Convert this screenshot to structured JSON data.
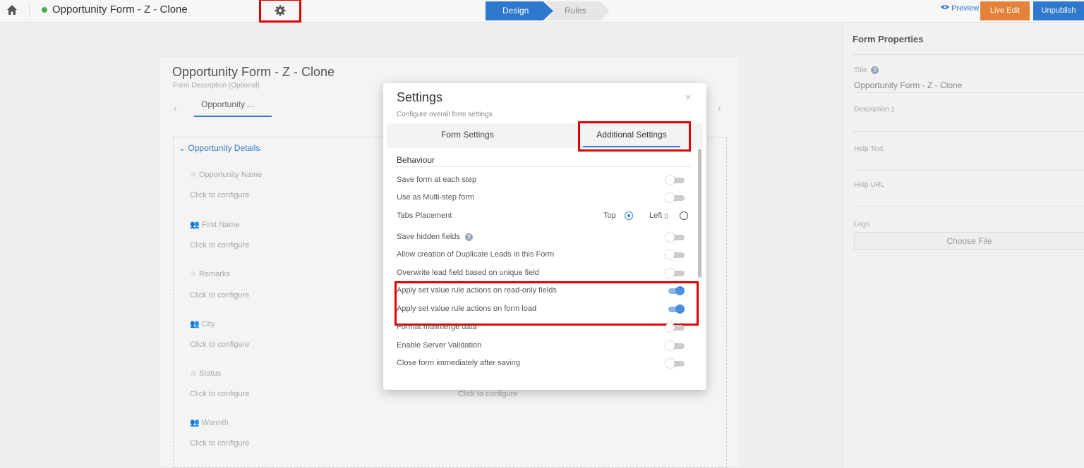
{
  "topbar": {
    "form_name": "Opportunity Form - Z - Clone",
    "steps": [
      "Design",
      "Rules"
    ],
    "preview_label": "Preview",
    "live_edit_label": "Live Edit",
    "unpublish_label": "Unpublish"
  },
  "properties": {
    "heading": "Form Properties",
    "title_label": "Title",
    "title_value": "Opportunity Form - Z - Clone",
    "description_label": "Description",
    "help_text_label": "Help Text",
    "help_url_label": "Help URL",
    "logo_label": "Logo",
    "choose_file_label": "Choose File"
  },
  "canvas": {
    "title": "Opportunity Form - Z - Clone",
    "description_placeholder": "Form Description (Optional)",
    "tab_label": "Opportunity ...",
    "section_title": "Opportunity Details",
    "configure_text": "Click to configure",
    "fields": [
      {
        "label": "Opportunity Name",
        "icon": "field-icon"
      },
      {
        "label": "First Name",
        "icon": "users-icon"
      },
      {
        "label": "Remarks",
        "icon": "field-icon"
      },
      {
        "label": "City",
        "icon": "users-icon"
      },
      {
        "label": "Status",
        "icon": "field-icon"
      },
      {
        "label": "Warmth",
        "icon": "users-icon"
      }
    ]
  },
  "modal": {
    "title": "Settings",
    "subtitle": "Configure overall form settings",
    "close_symbol": "×",
    "tabs": [
      "Form Settings",
      "Additional Settings"
    ],
    "active_tab": "Additional Settings",
    "section": "Behaviour",
    "settings": [
      {
        "label": "Save form at each step",
        "enabled": false
      },
      {
        "label": "Use as Multi-step form",
        "enabled": false
      },
      {
        "label": "Tabs Placement",
        "options": [
          "Top",
          "Left"
        ],
        "selected": "Top"
      },
      {
        "label": "Save hidden fields",
        "enabled": false,
        "help": true
      },
      {
        "label": "Allow creation of Duplicate Leads in this Form",
        "enabled": false
      },
      {
        "label": "Overwrite lead field based on unique field",
        "enabled": false
      },
      {
        "label": "Apply set value rule actions on read-only fields",
        "enabled": true
      },
      {
        "label": "Apply set value rule actions on form load",
        "enabled": true
      },
      {
        "label": "Format mailmerge data",
        "enabled": false
      },
      {
        "label": "Enable Server Validation",
        "enabled": false
      },
      {
        "label": "Close form immediately after saving",
        "enabled": false
      }
    ]
  },
  "colors": {
    "accent": "#2f7bd0",
    "live_edit": "#e8843a",
    "annotation": "#e00000",
    "status_dot": "#4caf50"
  }
}
